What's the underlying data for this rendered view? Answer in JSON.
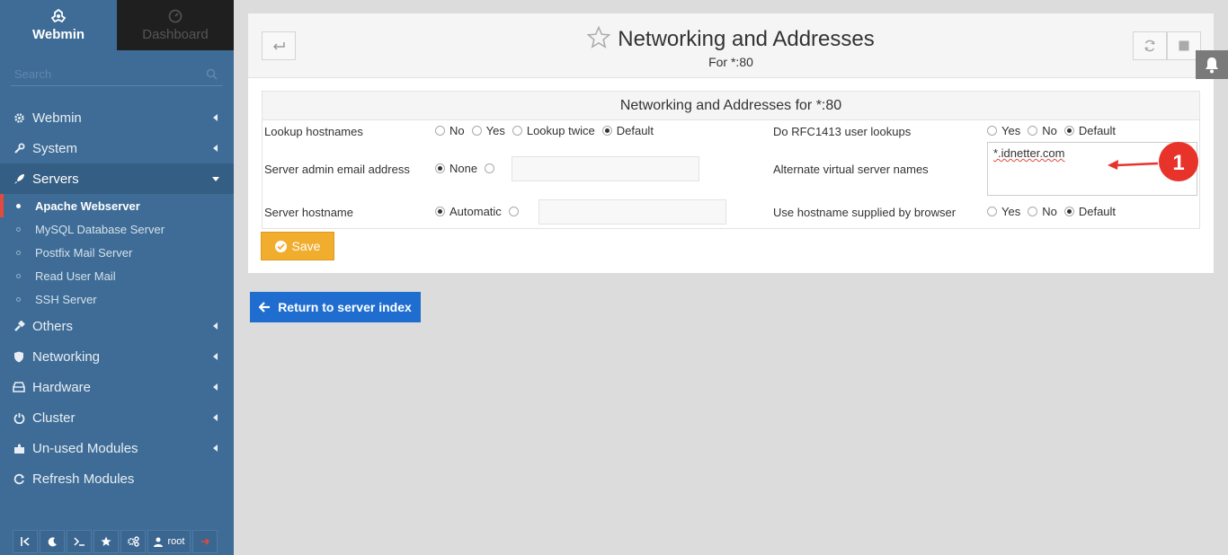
{
  "sidebar": {
    "tabs": {
      "webmin": "Webmin",
      "dashboard": "Dashboard"
    },
    "search_placeholder": "Search",
    "items": [
      {
        "label": "Webmin",
        "icon": "gear-icon"
      },
      {
        "label": "System",
        "icon": "wrench-icon"
      },
      {
        "label": "Servers",
        "icon": "rocket-icon"
      },
      {
        "label": "Others",
        "icon": "tools-icon"
      },
      {
        "label": "Networking",
        "icon": "shield-icon"
      },
      {
        "label": "Hardware",
        "icon": "hdd-icon"
      },
      {
        "label": "Cluster",
        "icon": "power-icon"
      },
      {
        "label": "Un-used Modules",
        "icon": "puzzle-icon"
      },
      {
        "label": "Refresh Modules",
        "icon": "refresh-icon"
      }
    ],
    "servers_sub": [
      "Apache Webserver",
      "MySQL Database Server",
      "Postfix Mail Server",
      "Read User Mail",
      "SSH Server"
    ],
    "bottom_user": "root"
  },
  "header": {
    "title": "Networking and Addresses",
    "subtitle": "For *:80"
  },
  "form": {
    "title": "Networking and Addresses for *:80",
    "lookup_hostnames": {
      "label": "Lookup hostnames",
      "options": [
        "No",
        "Yes",
        "Lookup twice",
        "Default"
      ],
      "selected": "Default"
    },
    "rfc1413": {
      "label": "Do RFC1413 user lookups",
      "options": [
        "Yes",
        "No",
        "Default"
      ],
      "selected": "Default"
    },
    "admin_email": {
      "label": "Server admin email address",
      "option_none": "None",
      "value": ""
    },
    "alt_names": {
      "label": "Alternate virtual server names",
      "value": "*.idnetter.com"
    },
    "hostname": {
      "label": "Server hostname",
      "option_auto": "Automatic",
      "value": ""
    },
    "use_hostname": {
      "label": "Use hostname supplied by browser",
      "options": [
        "Yes",
        "No",
        "Default"
      ],
      "selected": "Default"
    },
    "save": "Save"
  },
  "return_button": "Return to server index",
  "annotation": {
    "number": "1",
    "color": "#e8332b"
  },
  "colors": {
    "sidebar": "#3e6c96",
    "save": "#f0ad2e",
    "primary": "#1f6ecf",
    "active_marker": "#e04a3f"
  }
}
